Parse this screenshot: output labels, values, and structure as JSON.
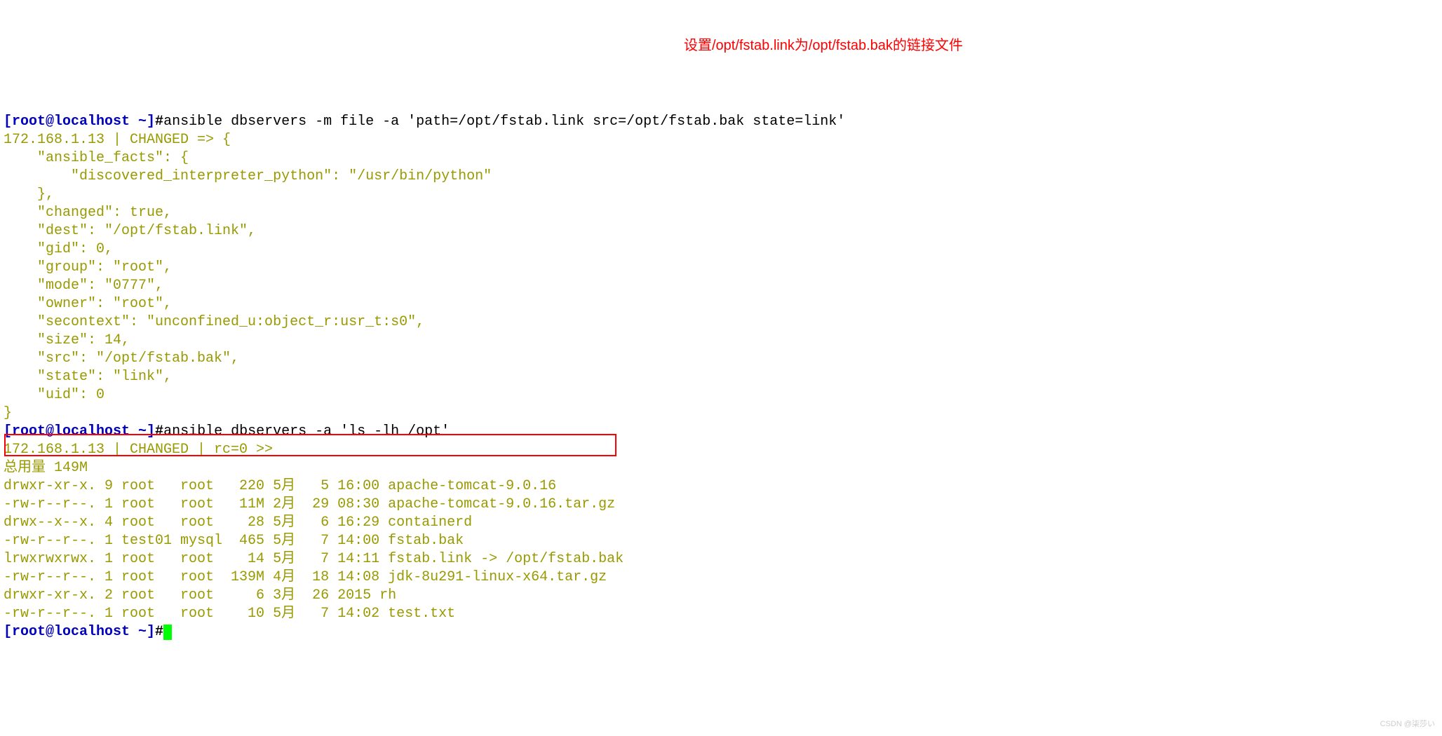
{
  "annotation": "设置/opt/fstab.link为/opt/fstab.bak的链接文件",
  "prompt1": {
    "user": "[root@localhost ~]",
    "hash": "#",
    "command": "ansible dbservers -m file -a 'path=/opt/fstab.link src=/opt/fstab.bak state=link'"
  },
  "output1_lines": [
    "172.168.1.13 | CHANGED => {",
    "    \"ansible_facts\": {",
    "        \"discovered_interpreter_python\": \"/usr/bin/python\"",
    "    },",
    "    \"changed\": true,",
    "    \"dest\": \"/opt/fstab.link\",",
    "    \"gid\": 0,",
    "    \"group\": \"root\",",
    "    \"mode\": \"0777\",",
    "    \"owner\": \"root\",",
    "    \"secontext\": \"unconfined_u:object_r:usr_t:s0\",",
    "    \"size\": 14,",
    "    \"src\": \"/opt/fstab.bak\",",
    "    \"state\": \"link\",",
    "    \"uid\": 0",
    "}"
  ],
  "prompt2": {
    "user": "[root@localhost ~]",
    "hash": "#",
    "command": "ansible dbservers -a 'ls -lh /opt'"
  },
  "output2_lines": [
    "172.168.1.13 | CHANGED | rc=0 >>",
    "总用量 149M",
    "drwxr-xr-x. 9 root   root   220 5月   5 16:00 apache-tomcat-9.0.16",
    "-rw-r--r--. 1 root   root   11M 2月  29 08:30 apache-tomcat-9.0.16.tar.gz",
    "drwx--x--x. 4 root   root    28 5月   6 16:29 containerd",
    "-rw-r--r--. 1 test01 mysql  465 5月   7 14:00 fstab.bak",
    "lrwxrwxrwx. 1 root   root    14 5月   7 14:11 fstab.link -> /opt/fstab.bak",
    "-rw-r--r--. 1 root   root  139M 4月  18 14:08 jdk-8u291-linux-x64.tar.gz",
    "drwxr-xr-x. 2 root   root     6 3月  26 2015 rh",
    "-rw-r--r--. 1 root   root    10 5月   7 14:02 test.txt"
  ],
  "prompt3": {
    "user": "[root@localhost ~]",
    "hash": "#"
  },
  "watermark": "CSDN @柒莎い"
}
